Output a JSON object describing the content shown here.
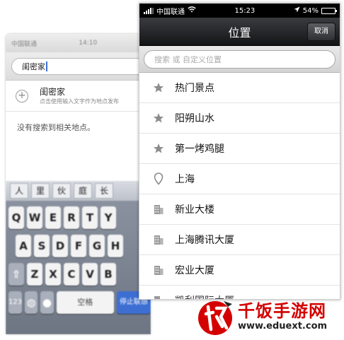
{
  "back_screen": {
    "status": {
      "carrier": "中国联通",
      "time": "14:10"
    },
    "search_value": "闺密家",
    "add_row": {
      "title": "闺密家",
      "subtitle": "点击使用输入文字作为地点发布"
    },
    "no_result": "没有搜索到相关地点。",
    "keyboard": {
      "candidates": [
        "人",
        "里",
        "伙",
        "庭",
        "长"
      ],
      "row1": [
        "Q",
        "W",
        "E",
        "R",
        "T",
        "Y"
      ],
      "row2": [
        "A",
        "S",
        "D",
        "F",
        "G",
        "H"
      ],
      "row3": [
        "Z",
        "X",
        "C",
        "V",
        "B"
      ],
      "numbers_key": "123",
      "space_key": "空格",
      "go_key": "停止联想"
    }
  },
  "front_screen": {
    "status": {
      "carrier": "中国联通",
      "time": "15:23",
      "battery": "54%",
      "battery_level": 0.54
    },
    "nav": {
      "title": "位置",
      "cancel": "取消"
    },
    "search": {
      "placeholder": "搜索 或 自定义位置"
    },
    "items": [
      {
        "label": "热门景点",
        "icon": "star-icon"
      },
      {
        "label": "阳朔山水",
        "icon": "star-icon"
      },
      {
        "label": "第一烤鸡腿",
        "icon": "star-icon"
      },
      {
        "label": "上海",
        "icon": "location-pin-icon"
      },
      {
        "label": "新业大楼",
        "icon": "building-icon"
      },
      {
        "label": "上海腾讯大厦",
        "icon": "building-icon"
      },
      {
        "label": "宏业大厦",
        "icon": "building-icon"
      },
      {
        "label": "凯利国际大厦",
        "icon": "building-icon"
      }
    ]
  },
  "watermark": {
    "name": "千饭手游网",
    "url": "www.eduext.com",
    "brand_color": "#d40000"
  }
}
